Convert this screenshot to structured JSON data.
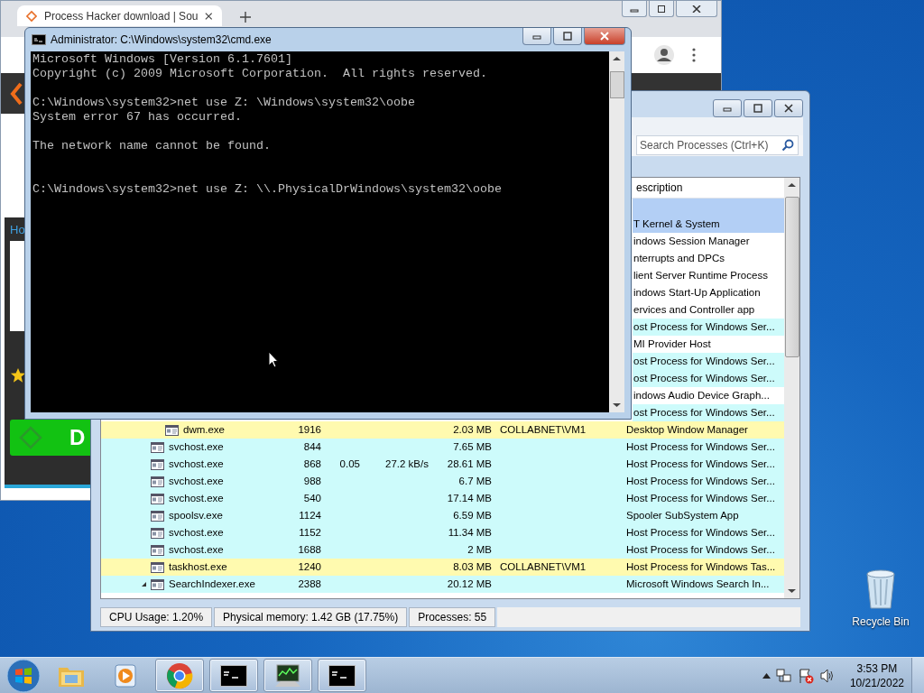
{
  "browser": {
    "tab_title": "Process Hacker download | Sou",
    "link_text": "Ho",
    "download_text": "D"
  },
  "console": {
    "title": "Administrator: C:\\Windows\\system32\\cmd.exe",
    "output": "Microsoft Windows [Version 6.1.7601]\nCopyright (c) 2009 Microsoft Corporation.  All rights reserved.\n\nC:\\Windows\\system32>net use Z: \\Windows\\system32\\oobe\nSystem error 67 has occurred.\n\nThe network name cannot be found.\n\n\nC:\\Windows\\system32>net use Z: \\\\.PhysicalDrWindows\\system32\\oobe"
  },
  "process_hacker": {
    "search": {
      "placeholder": "Search Processes (Ctrl+K)"
    },
    "column_header": "escription",
    "rows": [
      {
        "color": "#b3cff5"
      },
      {
        "description": "T Kernel & System",
        "color": "#b3cff5"
      },
      {
        "description": "indows Session Manager",
        "color": "#ffffff"
      },
      {
        "description": "nterrupts and DPCs",
        "color": "#ffffff"
      },
      {
        "description": "lient Server Runtime Process",
        "color": "#ffffff"
      },
      {
        "description": "indows Start-Up Application",
        "color": "#ffffff"
      },
      {
        "description": "ervices and Controller app",
        "color": "#ffffff"
      },
      {
        "description": "ost Process for Windows Ser...",
        "color": "#cdfbfb"
      },
      {
        "description": "MI Provider Host",
        "color": "#ffffff"
      },
      {
        "description": "ost Process for Windows Ser...",
        "color": "#cdfbfb"
      },
      {
        "description": "ost Process for Windows Ser...",
        "color": "#cdfbfb"
      },
      {
        "description": "indows Audio Device Graph...",
        "color": "#ffffff"
      },
      {
        "description": "ost Process for Windows Ser...",
        "color": "#cdfbfb",
        "children": [
          {
            "name": "dwm.exe",
            "pid": "1916",
            "private": "2.03 MB",
            "user": "COLLABNET\\VM1",
            "description": "Desktop Window Manager",
            "color": "#fffaaf"
          }
        ]
      },
      {
        "name": "svchost.exe",
        "pid": "844",
        "private": "7.65 MB",
        "description": "Host Process for Windows Ser...",
        "color": "#cdfbfb"
      },
      {
        "name": "svchost.exe",
        "pid": "868",
        "cpu": "0.05",
        "io": "27.2 kB/s",
        "private": "28.61 MB",
        "description": "Host Process for Windows Ser...",
        "color": "#cdfbfb"
      },
      {
        "name": "svchost.exe",
        "pid": "988",
        "private": "6.7 MB",
        "description": "Host Process for Windows Ser...",
        "color": "#cdfbfb"
      },
      {
        "name": "svchost.exe",
        "pid": "540",
        "private": "17.14 MB",
        "description": "Host Process for Windows Ser...",
        "color": "#cdfbfb"
      },
      {
        "name": "spoolsv.exe",
        "pid": "1124",
        "private": "6.59 MB",
        "description": "Spooler SubSystem App",
        "color": "#cdfbfb"
      },
      {
        "name": "svchost.exe",
        "pid": "1152",
        "private": "11.34 MB",
        "description": "Host Process for Windows Ser...",
        "color": "#cdfbfb"
      },
      {
        "name": "svchost.exe",
        "pid": "1688",
        "private": "2 MB",
        "description": "Host Process for Windows Ser...",
        "color": "#cdfbfb"
      },
      {
        "name": "taskhost.exe",
        "pid": "1240",
        "private": "8.03 MB",
        "user": "COLLABNET\\VM1",
        "description": "Host Process for Windows Tas...",
        "color": "#fffaaf"
      },
      {
        "name": "SearchIndexer.exe",
        "pid": "2388",
        "private": "20.12 MB",
        "description": "Microsoft Windows Search In...",
        "color": "#cdfbfb",
        "expanded": true
      }
    ],
    "status_bar": [
      "CPU Usage: 1.20%",
      "Physical memory: 1.42 GB (17.75%)",
      "Processes: 55"
    ]
  },
  "desktop_icons": [
    {
      "label": "Recycle Bin"
    }
  ],
  "taskbar": {
    "apps": [
      {
        "kind": "explorer",
        "running": false
      },
      {
        "kind": "media",
        "running": false
      },
      {
        "kind": "chrome",
        "running": true
      },
      {
        "kind": "console",
        "running": true
      },
      {
        "kind": "monitor",
        "running": true
      },
      {
        "kind": "console",
        "running": true
      }
    ],
    "time": "3:53 PM",
    "date": "10/21/2022"
  }
}
